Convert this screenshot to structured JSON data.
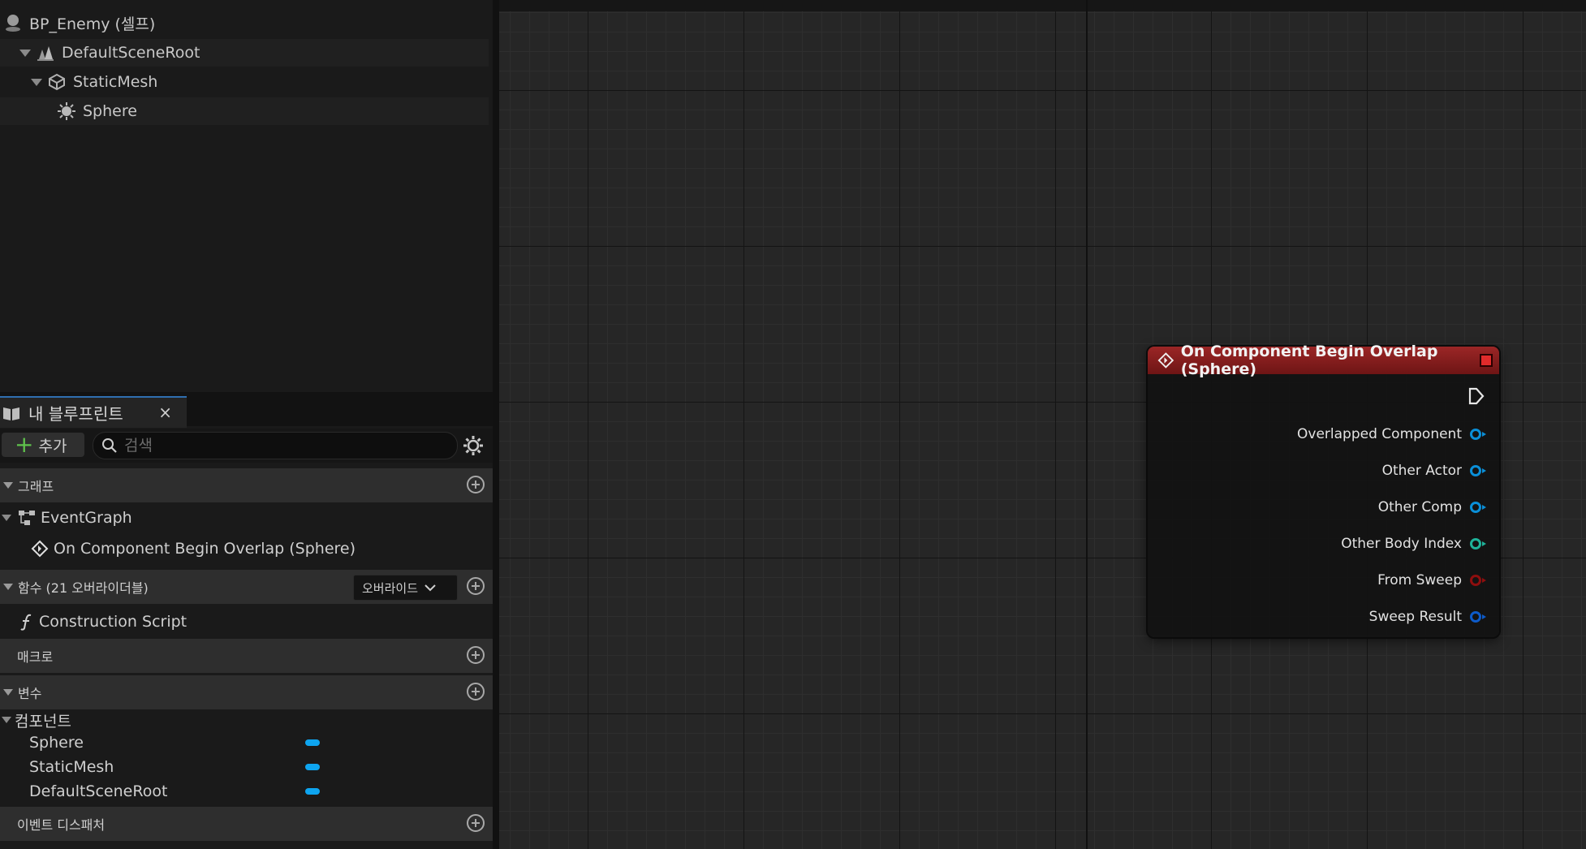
{
  "components_tree": {
    "root": "BP_Enemy (셀프)",
    "items": [
      "DefaultSceneRoot",
      "StaticMesh",
      "Sphere"
    ]
  },
  "my_blueprint": {
    "tab_label": "내 블루프린트",
    "close_glyph": "×",
    "add_label": "추가",
    "search_placeholder": "검색",
    "graphs_section": "그래프",
    "event_graph": "EventGraph",
    "event_item": "On Component Begin Overlap (Sphere)",
    "functions_section": "함수 (21 오버라이더블)",
    "override_label": "오버라이드",
    "construction_script": "Construction Script",
    "macros_section": "매크로",
    "variables_section": "변수",
    "components_category": "컴포넌트",
    "variables": [
      "Sphere",
      "StaticMesh",
      "DefaultSceneRoot"
    ],
    "dispatchers_section": "이벤트 디스패처"
  },
  "node": {
    "title": "On Component Begin Overlap (Sphere)",
    "pins": [
      {
        "label": "Overlapped Component",
        "color": "#0a8fd8"
      },
      {
        "label": "Other Actor",
        "color": "#0a8fd8"
      },
      {
        "label": "Other Comp",
        "color": "#0a8fd8"
      },
      {
        "label": "Other Body Index",
        "color": "#1fb39a"
      },
      {
        "label": "From Sweep",
        "color": "#8e0e0e"
      },
      {
        "label": "Sweep Result",
        "color": "#0d5bc9"
      }
    ]
  },
  "colors": {
    "node_header": "#9b2626",
    "variable_pill": "#0ea5f0",
    "add_plus": "#5fc24c"
  }
}
